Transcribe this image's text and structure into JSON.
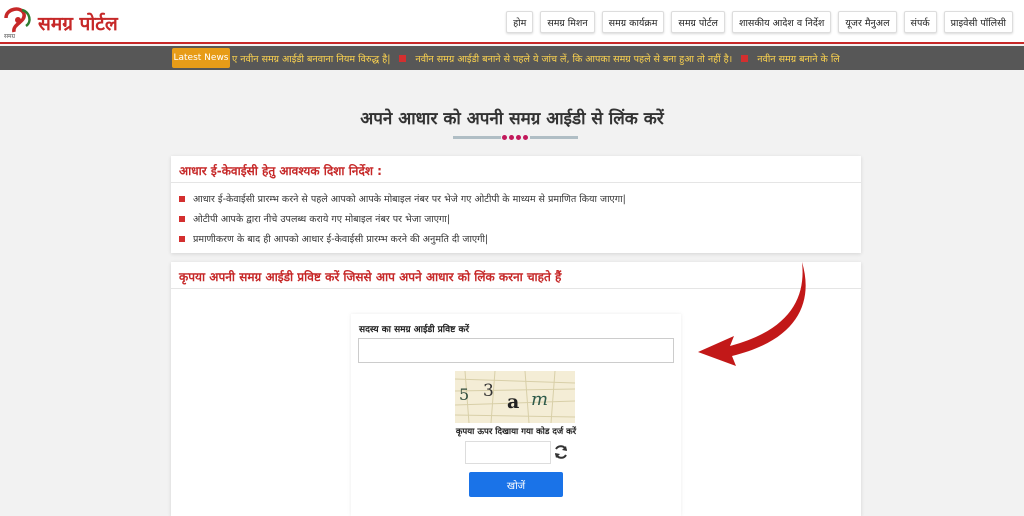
{
  "brand": {
    "logo_text": "समग्र पोर्टल",
    "logo_caption": "समग्र"
  },
  "nav": [
    {
      "label": "होम"
    },
    {
      "label": "समग्र मिशन"
    },
    {
      "label": "समग्र कार्यक्रम"
    },
    {
      "label": "समग्र पोर्टल"
    },
    {
      "label": "शासकीय आदेश व निर्देश"
    },
    {
      "label": "यूजर मैनुअल"
    },
    {
      "label": "संपर्क"
    },
    {
      "label": "प्राइवेसी पॉलिसी"
    }
  ],
  "ticker": {
    "badge": "Latest News",
    "items": [
      "ए नवीन समग्र आईडी बनवाना नियम विरुद्ध है|",
      "नवीन समग्र आईडी बनाने से पहले ये जांच लें, कि आपका समग्र पहले से बना हुआ तो नहीं है।",
      "नवीन समग्र बनाने के लि"
    ]
  },
  "page": {
    "title": "अपने आधार को अपनी समग्र आईडी से लिंक करें"
  },
  "instructions": {
    "heading": "आधार ई-केवाईसी हेतु आवश्यक दिशा निर्देश :",
    "items": [
      "आधार ई-केवाईसी प्रारम्भ करने से पहले आपको आपके मोबाइल नंबर पर भेजे गए ओटीपी के माध्यम से प्रमाणित किया जाएगा|",
      "ओटीपी आपके द्वारा नीचे उपलब्ध कराये गए मोबाइल नंबर पर भेजा जाएगा|",
      "प्रमाणीकरण के बाद ही आपको आधार ई-केवाईसी प्रारम्भ करने की अनुमति दी जाएगी|"
    ]
  },
  "form": {
    "heading": "कृपया अपनी समग्र आईडी प्रविष्ट करें जिससे आप अपने आधार को लिंक करना चाहते हैं",
    "samagra_label": "सदस्य का समग्र आईडी प्रविष्ट करें",
    "samagra_value": "",
    "captcha_chars": [
      "5",
      "3",
      "a",
      "m"
    ],
    "captcha_hint": "कृपया ऊपर दिखाया गया कोड दर्ज करें",
    "captcha_value": "",
    "search_label": "खोजें"
  },
  "colors": {
    "brand_red": "#c62828",
    "ticker_bg": "#575757",
    "badge": "#e79c18",
    "button": "#1a73e8"
  },
  "icons": {
    "refresh": "refresh-icon",
    "arrow": "pointer-arrow"
  }
}
